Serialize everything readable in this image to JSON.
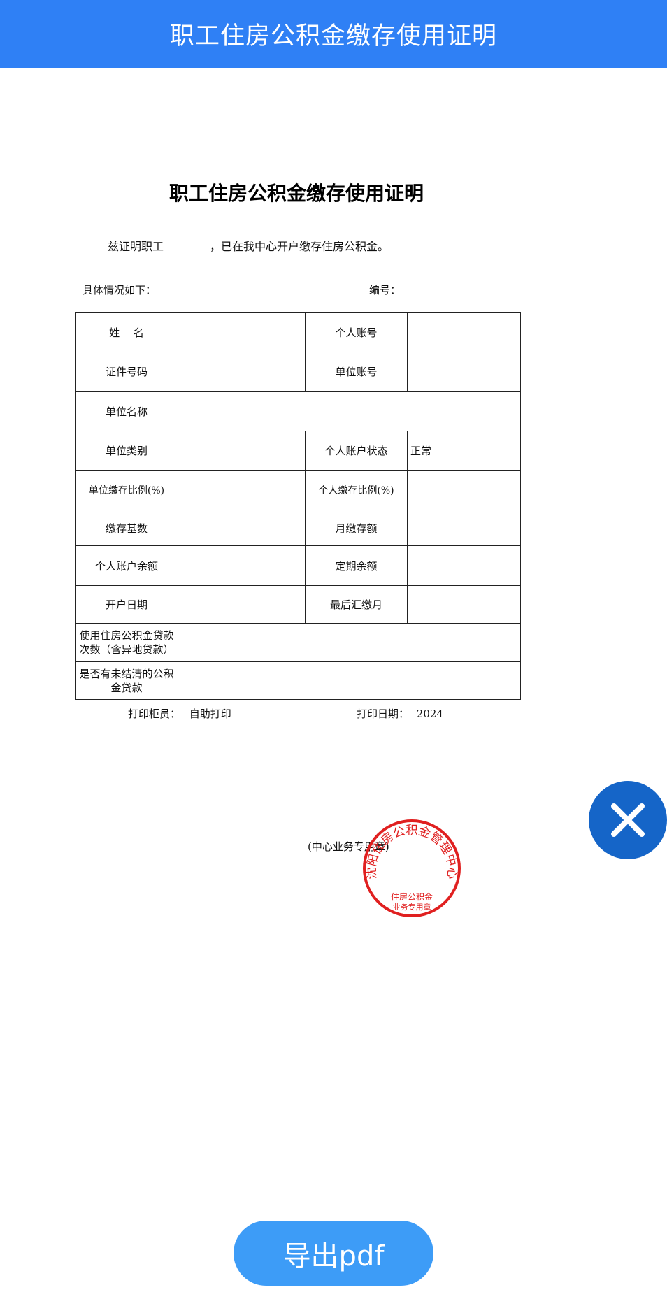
{
  "header": {
    "title": "职工住房公积金缴存使用证明"
  },
  "document": {
    "title": "职工住房公积金缴存使用证明",
    "intro_prefix": "兹证明职工",
    "intro_suffix": "，已在我中心开户缴存住房公积金。",
    "details_label": "具体情况如下：",
    "serial_label": "编号：",
    "table": {
      "name_label": "姓　 名",
      "personal_account_label": "个人账号",
      "id_number_label": "证件号码",
      "unit_account_label": "单位账号",
      "unit_name_label": "单位名称",
      "unit_type_label": "单位类别",
      "account_status_label": "个人账户状态",
      "account_status_value": "正常",
      "unit_ratio_label": "单位缴存比例(%)",
      "personal_ratio_label": "个人缴存比例(%)",
      "base_label": "缴存基数",
      "monthly_label": "月缴存额",
      "balance_label": "个人账户余额",
      "fixed_balance_label": "定期余额",
      "open_date_label": "开户日期",
      "last_month_label": "最后汇缴月",
      "loan_count_label": "使用住房公积金贷款次数（含异地贷款）",
      "unsettled_label": "是否有未结清的公积金贷款"
    },
    "printer_label": "打印柜员：",
    "printer_value": "自助打印",
    "print_date_label": "打印日期：",
    "print_date_value": "2024",
    "stamp_label": "(中心业务专用章)",
    "seal": {
      "arc_text": "沈阳住房公积金管理中心",
      "inner_line1": "住房公积金",
      "inner_line2": "业务专用章",
      "color": "#e02020"
    }
  },
  "controls": {
    "close_icon": "close-icon",
    "close_color": "#1565c8",
    "export_label": "导出pdf",
    "export_color": "#3d9cf7"
  }
}
